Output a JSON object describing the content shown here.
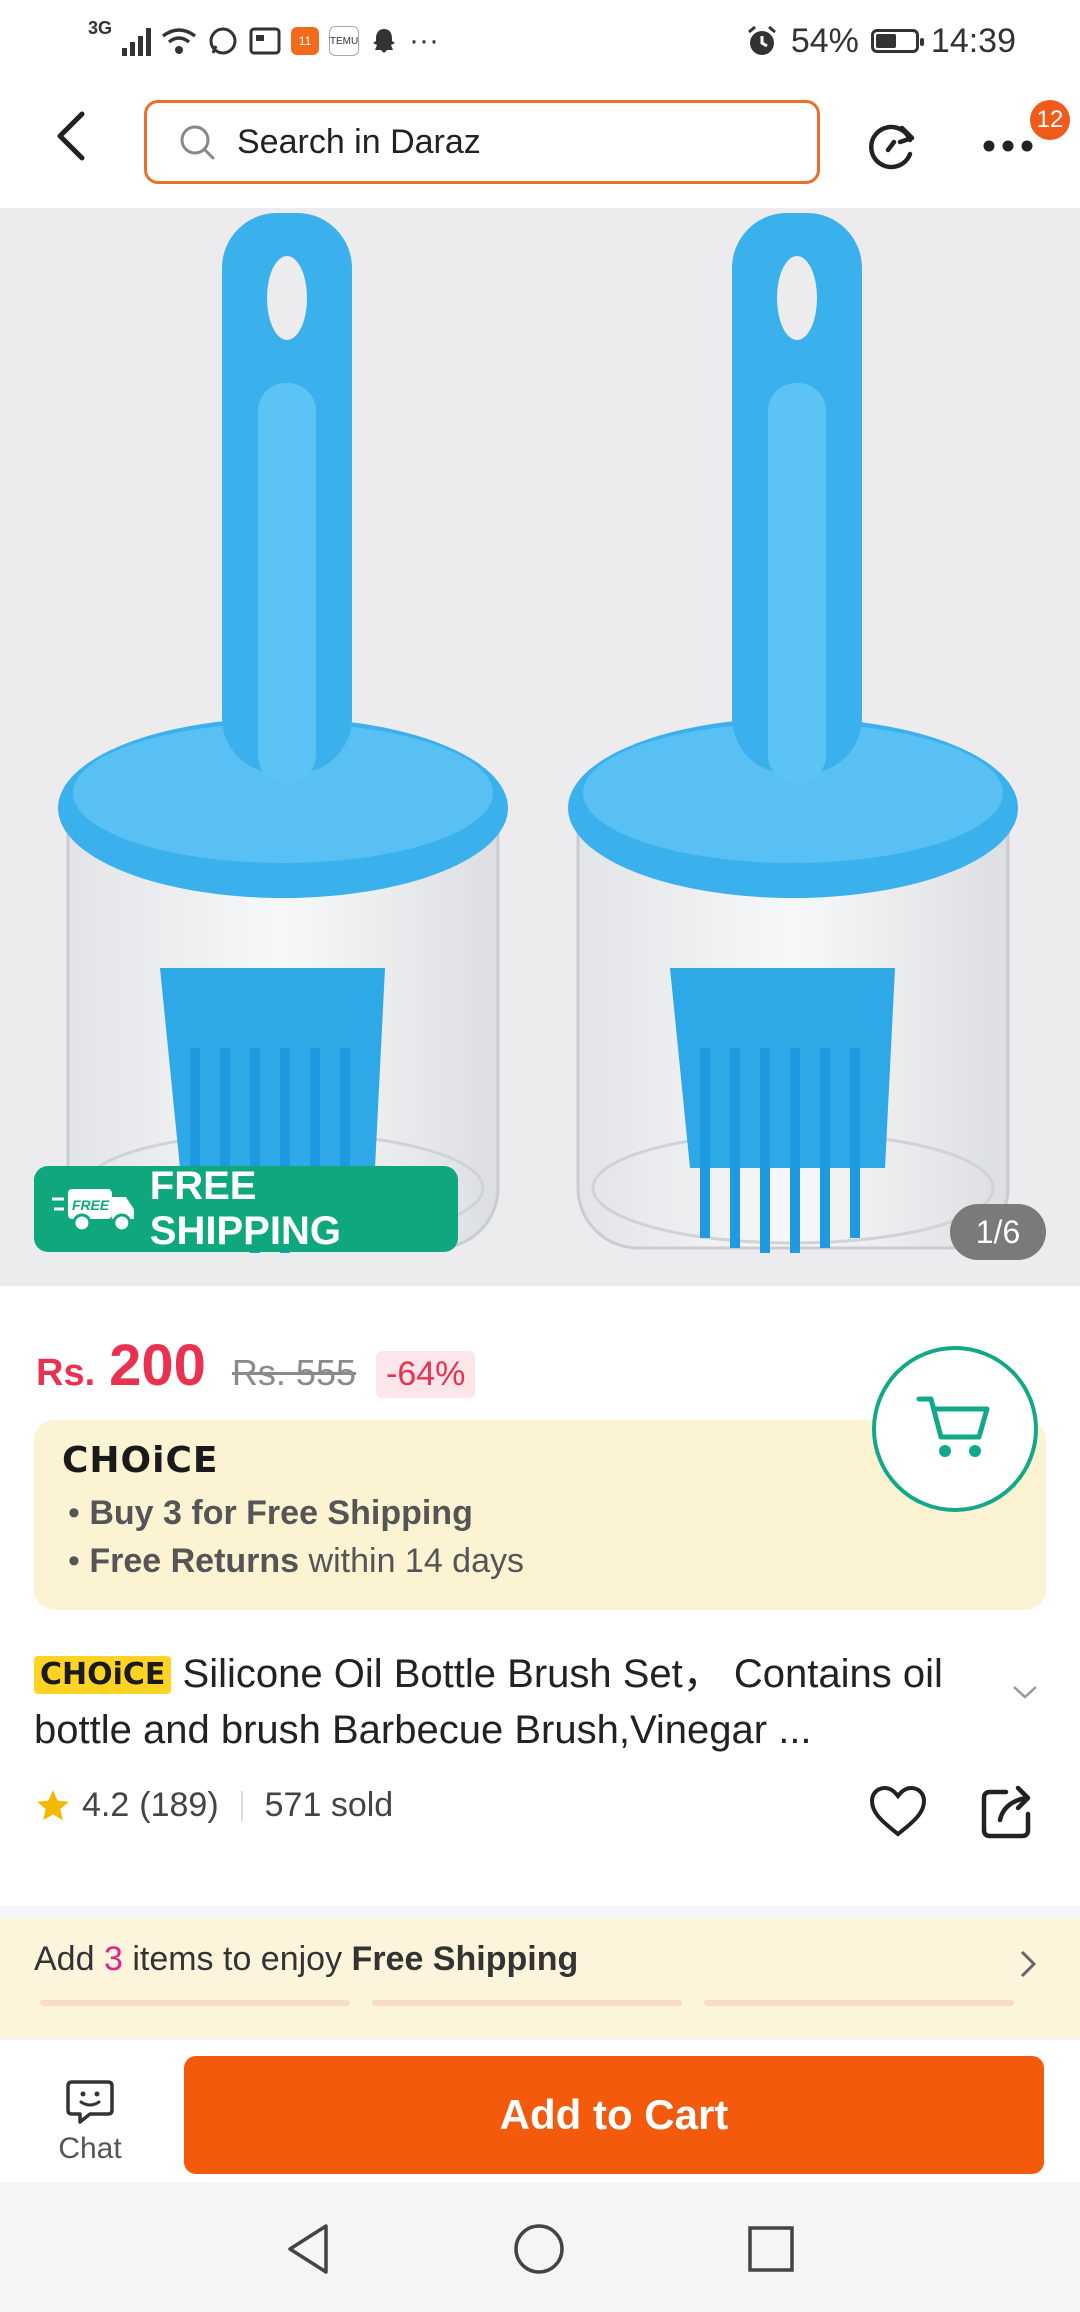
{
  "status_bar": {
    "network": "3G",
    "battery": "54%",
    "battery_level": 0.54,
    "time": "14:39"
  },
  "header": {
    "search_placeholder": "Search in Daraz",
    "cart_badge": "12"
  },
  "gallery": {
    "free_shipping_tag": "FREE",
    "free_shipping_label": "FREE SHIPPING",
    "counter": "1/6"
  },
  "price": {
    "currency": "Rs.",
    "current": "200",
    "original": "Rs. 555",
    "discount": "-64%"
  },
  "choice_box": {
    "logo": "CHOiCE",
    "bullet1_bold": "Buy 3 for  Free Shipping",
    "bullet2_bold": "Free Returns",
    "bullet2_rest": "within 14 days"
  },
  "product": {
    "tag": "CHOiCE",
    "title": "Silicone Oil Bottle Brush Set， Contains oil bottle and brush Barbecue Brush,Vinegar ..."
  },
  "rating": {
    "score": "4.2",
    "count": "(189)",
    "sold": "571 sold"
  },
  "promo": {
    "prefix": "Add",
    "count": "3",
    "middle": "items to enjoy",
    "bold": "Free Shipping"
  },
  "bottom": {
    "chat_label": "Chat",
    "add_to_cart": "Add to Cart"
  },
  "colors": {
    "brand_orange": "#f45a0c",
    "price_red": "#e8324f",
    "choice_green": "#12a889",
    "free_ship_green": "#0fa77e"
  }
}
